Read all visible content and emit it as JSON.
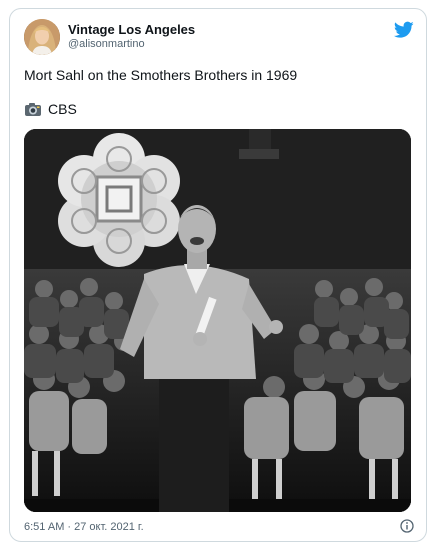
{
  "tweet": {
    "author_name": "Vintage Los Angeles",
    "author_handle": "@alisonmartino",
    "text": "Mort Sahl on the Smothers Brothers in 1969",
    "credit_emoji": "📷",
    "credit": "CBS",
    "timestamp": "6:51 AM · 27 окт. 2021 г."
  },
  "icons": {
    "brand": "twitter-bird-icon",
    "info": "info-icon"
  },
  "colors": {
    "brand": "#1d9bf0",
    "border": "#cfd9de",
    "muted": "#536471"
  }
}
